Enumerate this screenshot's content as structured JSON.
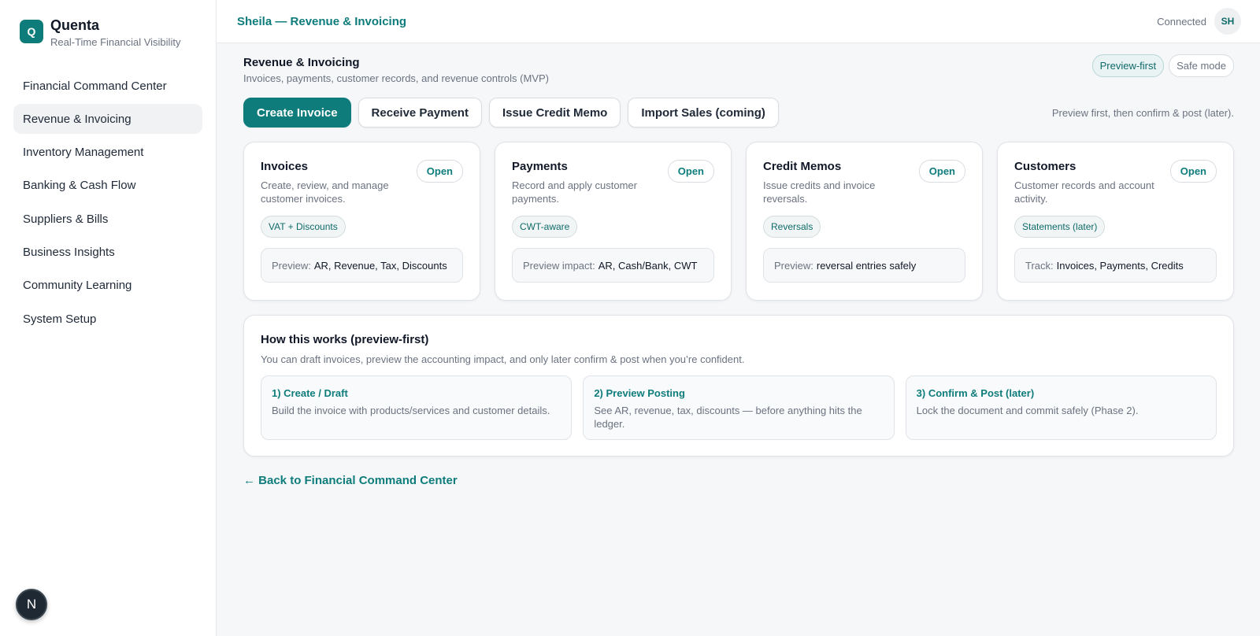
{
  "brand": {
    "logo_letter": "Q",
    "name": "Quenta",
    "tagline": "Real-Time Financial Visibility"
  },
  "sidebar": {
    "items": [
      {
        "label": "Financial Command Center"
      },
      {
        "label": "Revenue & Invoicing"
      },
      {
        "label": "Inventory Management"
      },
      {
        "label": "Banking & Cash Flow"
      },
      {
        "label": "Suppliers & Bills"
      },
      {
        "label": "Business Insights"
      },
      {
        "label": "Community Learning"
      },
      {
        "label": "System Setup"
      }
    ],
    "active_index": 1,
    "badge_letter": "N"
  },
  "topbar": {
    "title": "Sheila — Revenue & Invoicing",
    "status": "Connected",
    "avatar_initials": "SH"
  },
  "page": {
    "title": "Revenue & Invoicing",
    "subtitle": "Invoices, payments, customer records, and revenue controls (MVP)",
    "pills": {
      "preview_first": "Preview-first",
      "safe_mode": "Safe mode"
    }
  },
  "actions": {
    "create_invoice": "Create Invoice",
    "receive_payment": "Receive Payment",
    "issue_credit_memo": "Issue Credit Memo",
    "import_sales": "Import Sales (coming)",
    "note": "Preview first, then confirm & post (later)."
  },
  "cards": [
    {
      "title": "Invoices",
      "desc": "Create, review, and manage customer invoices.",
      "open": "Open",
      "tag": "VAT + Discounts",
      "preview_label": "Preview:",
      "preview_value": "AR, Revenue, Tax, Discounts"
    },
    {
      "title": "Payments",
      "desc": "Record and apply customer payments.",
      "open": "Open",
      "tag": "CWT-aware",
      "preview_label": "Preview impact:",
      "preview_value": "AR, Cash/Bank, CWT"
    },
    {
      "title": "Credit Memos",
      "desc": "Issue credits and invoice reversals.",
      "open": "Open",
      "tag": "Reversals",
      "preview_label": "Preview:",
      "preview_value": "reversal entries safely"
    },
    {
      "title": "Customers",
      "desc": "Customer records and account activity.",
      "open": "Open",
      "tag": "Statements (later)",
      "preview_label": "Track:",
      "preview_value": "Invoices, Payments, Credits"
    }
  ],
  "how": {
    "title": "How this works (preview-first)",
    "subtitle": "You can draft invoices, preview the accounting impact, and only later confirm & post when you’re confident.",
    "steps": [
      {
        "title": "1) Create / Draft",
        "desc": "Build the invoice with products/services and customer details."
      },
      {
        "title": "2) Preview Posting",
        "desc": "See AR, revenue, tax, discounts — before anything hits the ledger."
      },
      {
        "title": "3) Confirm & Post (later)",
        "desc": "Lock the document and commit safely (Phase 2)."
      }
    ]
  },
  "back_link": "← Back to Financial Command Center",
  "colors": {
    "accent": "#0f7c7c",
    "background": "#f6f7f9"
  }
}
